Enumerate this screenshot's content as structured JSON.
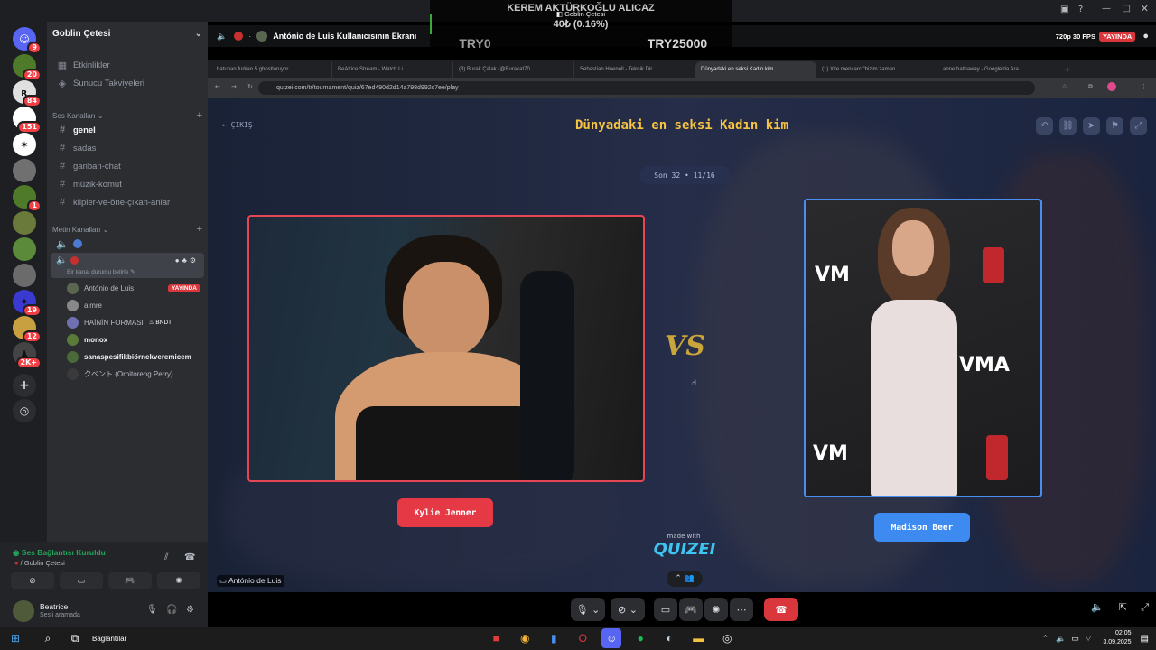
{
  "overlay": {
    "line1": "KEREM AKTÜRKOĞLU ALICAZ",
    "badge": "Goblin Çetesi",
    "line2": "40₺ (0.16%)",
    "left_amount": "TRY0",
    "right_amount": "TRY25000"
  },
  "server": {
    "name": "Goblin Çetesi"
  },
  "servers": [
    {
      "badge": "20"
    },
    {
      "badge": "84"
    },
    {
      "badge": "151"
    },
    {
      "badge": ""
    },
    {
      "badge": ""
    },
    {
      "badge": "1"
    },
    {
      "badge": ""
    },
    {
      "badge": ""
    },
    {
      "badge": ""
    },
    {
      "badge": "19"
    },
    {
      "badge": "12"
    },
    {
      "badge": "2K+"
    }
  ],
  "server_top_badge": "9",
  "nav": {
    "events": "Etkinlikler",
    "boosts": "Sunucu Takviyeleri"
  },
  "voice_category": "Ses Kanalları",
  "text_category": "Metin Kanalları",
  "channels": [
    "genel",
    "sadas",
    "gariban-chat",
    "müzik-komut",
    "klipler-ve-öne-çıkan-anlar"
  ],
  "channel_status": "Bir kanal durumu belirle",
  "voice_users": [
    {
      "name": "António de Luis",
      "tag": "YAYINDA"
    },
    {
      "name": "aimre",
      "tag": ""
    },
    {
      "name": "HAİNİN FORMASI",
      "tag": "BNDT"
    },
    {
      "name": "monox",
      "tag": ""
    },
    {
      "name": "sanaspesifikbiörnekveremicem",
      "tag": ""
    },
    {
      "name": "クベント (Ornitoreng Perry)",
      "tag": ""
    }
  ],
  "connection": {
    "status": "Ses Bağlantısı Kuruldu",
    "location": "/ Goblin Çetesi"
  },
  "user": {
    "name": "Beatrice",
    "status": "Sesli aramada"
  },
  "stream": {
    "title": "António de Luis Kullanıcısının Ekranı",
    "quality": "720p 30 FPS",
    "live": "YAYINDA",
    "owner_label": "António de Luis"
  },
  "browser": {
    "tabs": [
      "batuhan furkan 5 ghostlanıyor",
      "BeAttice Stream - Watch Li...",
      "(3) Burak Çalak (@Burakat70...",
      "Sebastian Hoenell - Teknik Dir...",
      "Dünyadaki en seksi Kadın kim",
      "(1) X'te mencarc \"bizim zaman...",
      "anne hathaway - Google'da Ara"
    ],
    "active_tab": 4,
    "url": "quizei.com/tr/tournament/quiz/67ed490d2d14a798d992c7ee/play"
  },
  "quiz": {
    "back": "ÇIKIŞ",
    "title": "Dünyadaki en seksi Kadın kim",
    "round": "Son 32 • 11/16",
    "left_name": "Kylie Jenner",
    "right_name": "Madison Beer",
    "vs": "VS",
    "made_with": "made with",
    "brand": "QUIZEI"
  },
  "taskbar": {
    "search_hint": "Ara",
    "connections": "Bağlantılar",
    "time": "02:05",
    "date": "3.09.2025"
  },
  "colors": {
    "live": "#da373c",
    "left_accent": "#e64553",
    "right_accent": "#3d8bf0",
    "title": "#f6c343"
  }
}
